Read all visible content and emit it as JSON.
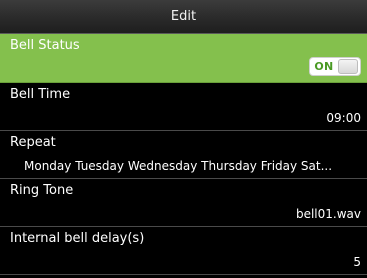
{
  "header": {
    "title": "Edit"
  },
  "settings": [
    {
      "label": "Bell Status",
      "toggle": {
        "text": "ON",
        "state": "on"
      }
    },
    {
      "label": "Bell Time",
      "value": "09:00"
    },
    {
      "label": "Repeat",
      "value": "Monday Tuesday Wednesday Thursday Friday Sat..."
    },
    {
      "label": "Ring Tone",
      "value": "bell01.wav"
    },
    {
      "label": "Internal bell delay(s)",
      "value": "5"
    }
  ],
  "colors": {
    "selected_row": "#84c04d",
    "toggle_text": "#4a9a24",
    "background": "#000000"
  }
}
